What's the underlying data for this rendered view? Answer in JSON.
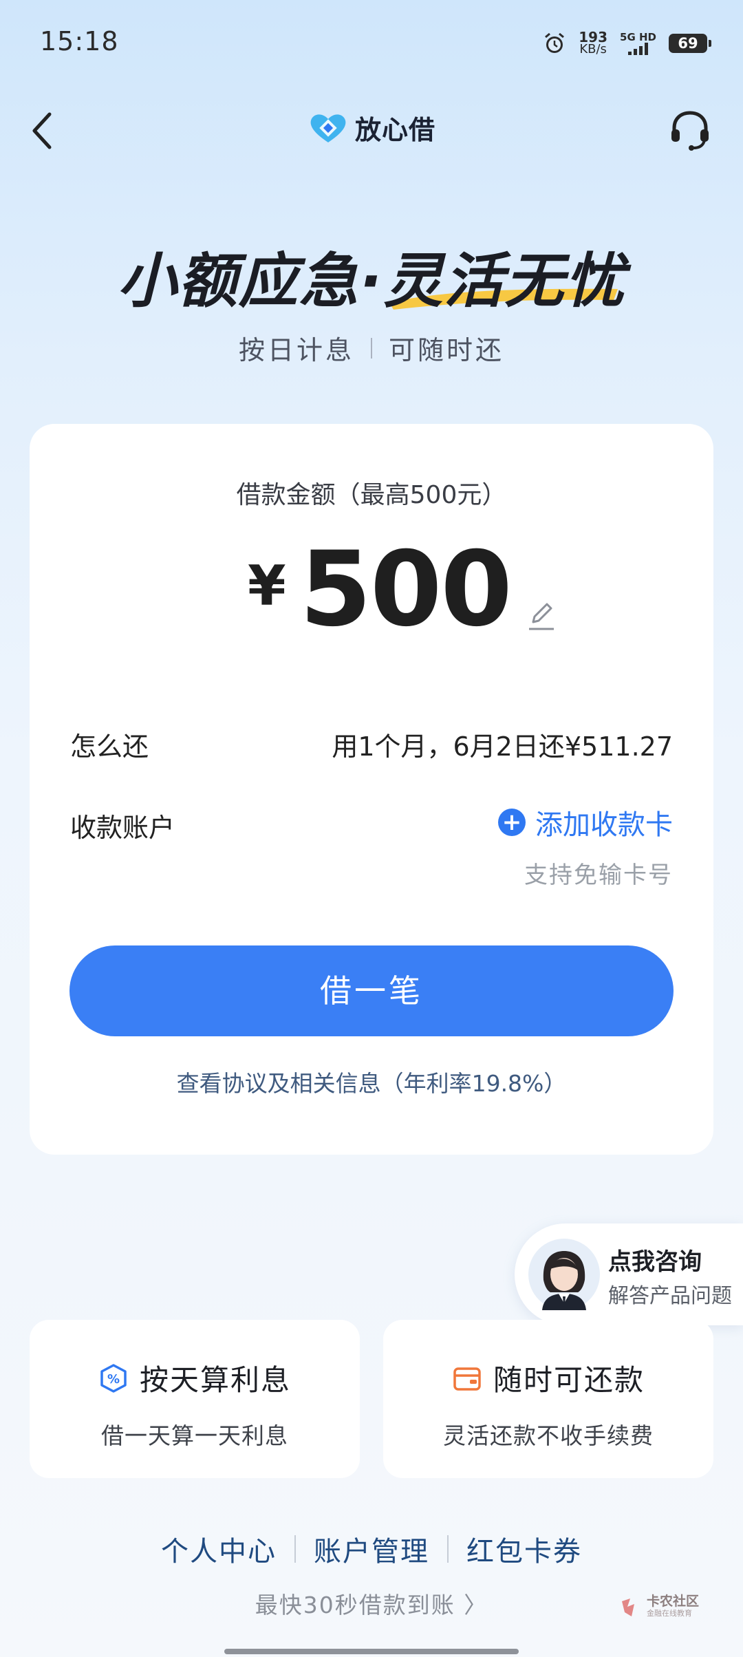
{
  "status_bar": {
    "time": "15:18",
    "net_speed_value": "193",
    "net_speed_unit": "KB/s",
    "network": "5G HD",
    "battery": "69"
  },
  "header": {
    "brand_name": "放心借",
    "icons": {
      "back": "chevron-left-icon",
      "support": "headset-icon",
      "logo": "heart-logo-icon"
    }
  },
  "hero": {
    "title_part1": "小额应急·",
    "title_part2": "灵活无忧",
    "sub_left": "按日计息",
    "sub_right": "可随时还"
  },
  "loan_card": {
    "amount_label": "借款金额（最高500元）",
    "currency": "¥",
    "amount": "500",
    "repay_label": "怎么还",
    "repay_value": "用1个月，6月2日还¥511.27",
    "account_label": "收款账户",
    "add_card_label": "添加收款卡",
    "add_card_sub": "支持免输卡号",
    "borrow_button": "借一笔",
    "agreement_link": "查看协议及相关信息（年利率19.8%）"
  },
  "consult": {
    "title": "点我咨询",
    "subtitle": "解答产品问题"
  },
  "features": [
    {
      "title": "按天算利息",
      "subtitle": "借一天算一天利息",
      "icon": "percent-badge-icon"
    },
    {
      "title": "随时可还款",
      "subtitle": "灵活还款不收手续费",
      "icon": "wallet-icon"
    }
  ],
  "bottom_nav": {
    "links": [
      "个人中心",
      "账户管理",
      "红包卡券"
    ],
    "tip": "最快30秒借款到账 〉"
  },
  "watermark": {
    "name": "卡农社区",
    "tagline": "金融在线教育"
  },
  "colors": {
    "primary_button": "#3a7ff5",
    "link_blue": "#2f78f2",
    "highlight_yellow": "#f7c843"
  }
}
